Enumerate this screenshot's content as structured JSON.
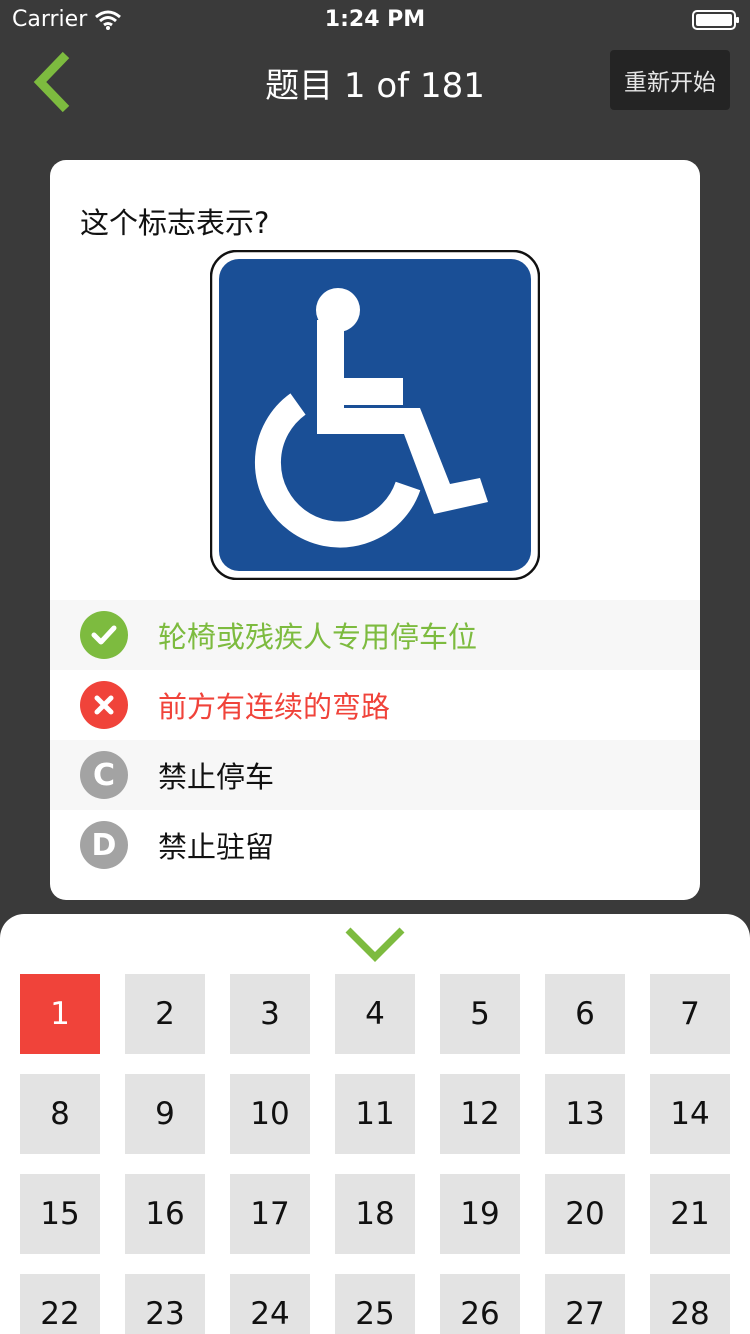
{
  "status_bar": {
    "carrier": "Carrier",
    "time": "1:24 PM"
  },
  "nav": {
    "title": "题目 1 of 181",
    "restart_label": "重新开始",
    "accent_color": "#7dbb3f"
  },
  "question": {
    "text": "这个标志表示?",
    "sign_color": "#1a4f96",
    "options": [
      {
        "badge": "check-icon",
        "letter": "",
        "label": "轮椅或残疾人专用停车位",
        "state": "correct",
        "color": "#7dbb3f"
      },
      {
        "badge": "cross-icon",
        "letter": "",
        "label": "前方有连续的弯路",
        "state": "wrong",
        "color": "#f0433a"
      },
      {
        "badge": "letter-badge",
        "letter": "C",
        "label": "禁止停车",
        "state": "neutral",
        "color": "#a3a3a3"
      },
      {
        "badge": "letter-badge",
        "letter": "D",
        "label": "禁止驻留",
        "state": "neutral",
        "color": "#a3a3a3"
      }
    ]
  },
  "question_grid": {
    "current": "1",
    "current_color": "#f0433a",
    "cells": [
      "1",
      "2",
      "3",
      "4",
      "5",
      "6",
      "7",
      "8",
      "9",
      "10",
      "11",
      "12",
      "13",
      "14",
      "15",
      "16",
      "17",
      "18",
      "19",
      "20",
      "21",
      "22",
      "23",
      "24",
      "25",
      "26",
      "27",
      "28"
    ]
  }
}
